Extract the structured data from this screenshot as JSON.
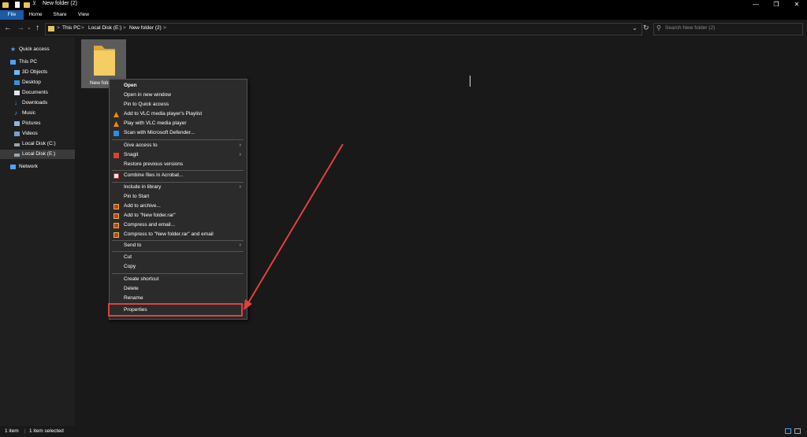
{
  "window": {
    "title": "New folder (2)",
    "minimize_glyph": "—",
    "maximize_glyph": "❐",
    "close_glyph": "✕"
  },
  "ribbon": {
    "tabs": [
      "File",
      "Home",
      "Share",
      "View"
    ],
    "active": "File",
    "active_color": "#1b5aa5"
  },
  "nav": {
    "back": "←",
    "forward": "→",
    "recent": "⌄",
    "up": "↑",
    "breadcrumb": [
      "This PC",
      "Local Disk (E:)",
      "New folder (2)"
    ],
    "separator": ">",
    "dropdown_glyph": "⌄",
    "refresh_glyph": "↻",
    "search_placeholder": "Search New folder (2)"
  },
  "sidebar": {
    "items": [
      {
        "label": "Quick access",
        "icon": "star-icon"
      },
      {
        "label": "This PC",
        "icon": "computer-icon"
      },
      {
        "label": "3D Objects",
        "icon": "cube-icon"
      },
      {
        "label": "Desktop",
        "icon": "desktop-icon"
      },
      {
        "label": "Documents",
        "icon": "documents-icon"
      },
      {
        "label": "Downloads",
        "icon": "download-icon"
      },
      {
        "label": "Music",
        "icon": "music-icon"
      },
      {
        "label": "Pictures",
        "icon": "pictures-icon"
      },
      {
        "label": "Videos",
        "icon": "videos-icon"
      },
      {
        "label": "Local Disk (C:)",
        "icon": "drive-icon"
      },
      {
        "label": "Local Disk (E:)",
        "icon": "drive-icon",
        "selected": true
      },
      {
        "label": "Network",
        "icon": "network-icon"
      }
    ]
  },
  "content": {
    "folder_label": "New fold"
  },
  "context_menu": {
    "groups": [
      [
        {
          "label": "Open",
          "bold": true
        },
        {
          "label": "Open in new window"
        },
        {
          "label": "Pin to Quick access"
        },
        {
          "label": "Add to VLC media player's Playlist",
          "icon": "vlc-icon"
        },
        {
          "label": "Play with VLC media player",
          "icon": "vlc-icon"
        },
        {
          "label": "Scan with Microsoft Defender...",
          "icon": "defender-icon"
        }
      ],
      [
        {
          "label": "Give access to",
          "submenu": true
        },
        {
          "label": "Snagit",
          "icon": "snagit-icon",
          "submenu": true
        },
        {
          "label": "Restore previous versions"
        }
      ],
      [
        {
          "label": "Combine files in Acrobat...",
          "icon": "acrobat-icon"
        }
      ],
      [
        {
          "label": "Include in library",
          "submenu": true
        },
        {
          "label": "Pin to Start"
        },
        {
          "label": "Add to archive...",
          "icon": "winrar-icon"
        },
        {
          "label": "Add to \"New folder.rar\"",
          "icon": "winrar-icon"
        },
        {
          "label": "Compress and email...",
          "icon": "winrar-icon"
        },
        {
          "label": "Compress to \"New folder.rar\" and email",
          "icon": "winrar-icon"
        }
      ],
      [
        {
          "label": "Send to",
          "submenu": true
        }
      ],
      [
        {
          "label": "Cut"
        },
        {
          "label": "Copy"
        }
      ],
      [
        {
          "label": "Create shortcut"
        },
        {
          "label": "Delete"
        },
        {
          "label": "Rename"
        }
      ],
      [
        {
          "label": "Properties"
        }
      ]
    ],
    "submenu_glyph": "›"
  },
  "annotation": {
    "color": "#e0413f"
  },
  "status": {
    "items": "1 item",
    "selected": "1 item selected"
  }
}
